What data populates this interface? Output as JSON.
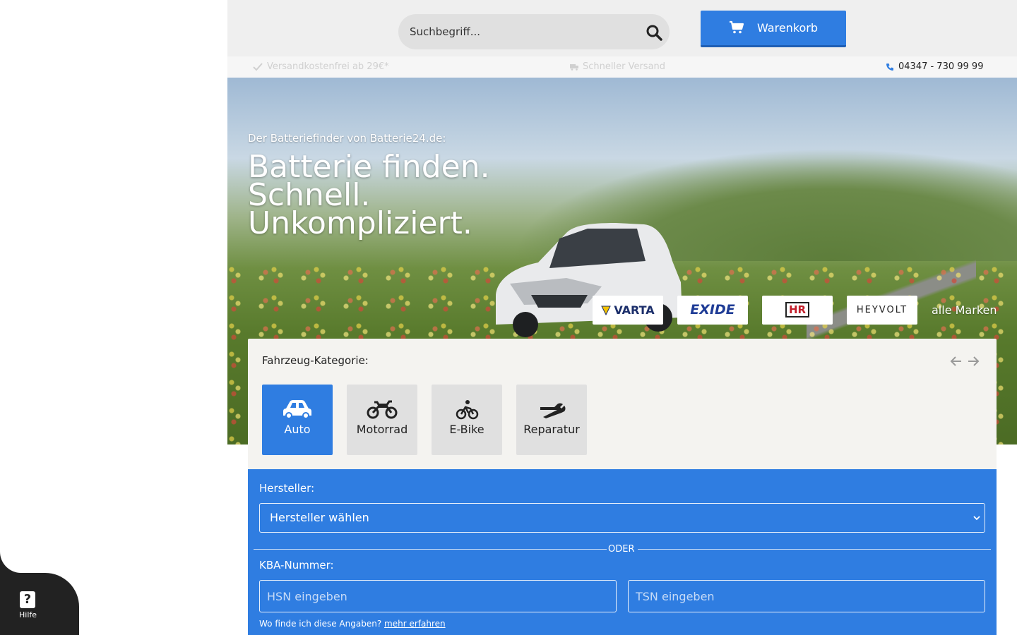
{
  "header": {
    "search_placeholder": "Suchbegriff...",
    "cart_label": "Warenkorb"
  },
  "info_bar": {
    "free_shipping": "Versandkostenfrei ab 29€*",
    "fast_shipping": "Schneller Versand",
    "phone": "04347 - 730 99 99"
  },
  "hero": {
    "subtitle": "Der Batteriefinder von Batterie24.de:",
    "headline_lines": [
      "Batterie finden.",
      "Schnell.",
      "Unkompliziert."
    ],
    "brands": [
      "VARTA",
      "EXIDE",
      "HR",
      "HEYVOLT"
    ],
    "all_brands_link": "alle Marken"
  },
  "finder": {
    "category_label": "Fahrzeug-Kategorie:",
    "categories": [
      {
        "label": "Auto",
        "icon": "car-icon",
        "active": true
      },
      {
        "label": "Motorrad",
        "icon": "motorcycle-icon",
        "active": false
      },
      {
        "label": "E-Bike",
        "icon": "bicycle-icon",
        "active": false
      },
      {
        "label": "Reparatur",
        "icon": "wrench-icon",
        "active": false
      }
    ]
  },
  "form": {
    "hersteller_label": "Hersteller:",
    "hersteller_placeholder": "Hersteller wählen",
    "oder": "ODER",
    "kba_label": "KBA-Nummer:",
    "hsn_placeholder": "HSN eingeben",
    "tsn_placeholder": "TSN eingeben",
    "hint_text": "Wo finde ich diese Angaben?",
    "hint_link": "mehr erfahren"
  },
  "help": {
    "label": "Hilfe"
  },
  "colors": {
    "accent_blue": "#2f7de1",
    "header_bg": "#efefef",
    "card_bg": "#f4f3f0"
  }
}
